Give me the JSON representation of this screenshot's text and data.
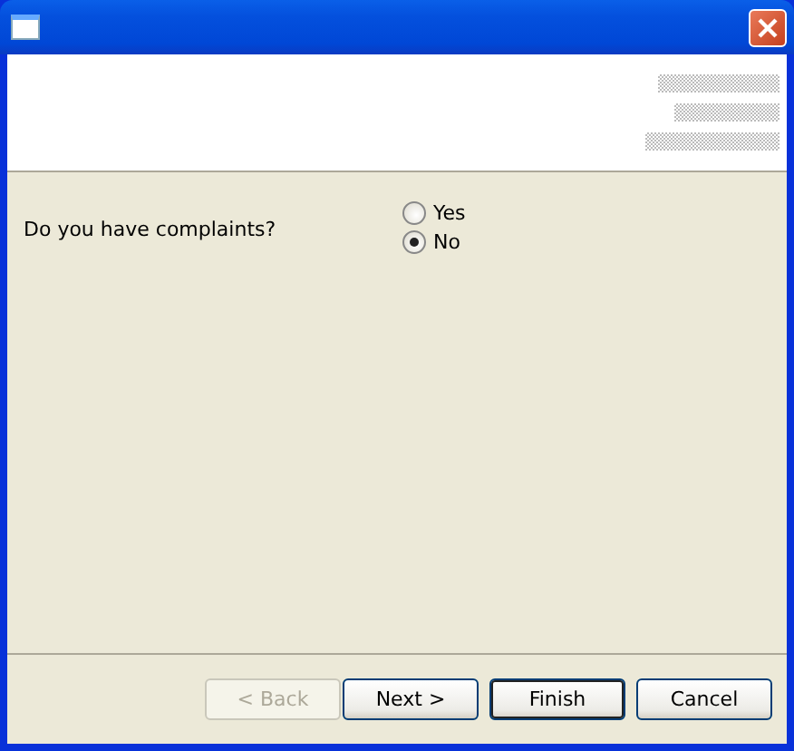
{
  "question": "Do you have complaints?",
  "options": [
    {
      "label": "Yes",
      "selected": false
    },
    {
      "label": "No",
      "selected": true
    }
  ],
  "buttons": [
    {
      "label": "< Back",
      "disabled": true,
      "default": false
    },
    {
      "label": "Next >",
      "disabled": false,
      "default": false
    },
    {
      "label": "Finish",
      "disabled": false,
      "default": true
    },
    {
      "label": "Cancel",
      "disabled": false,
      "default": false
    }
  ]
}
